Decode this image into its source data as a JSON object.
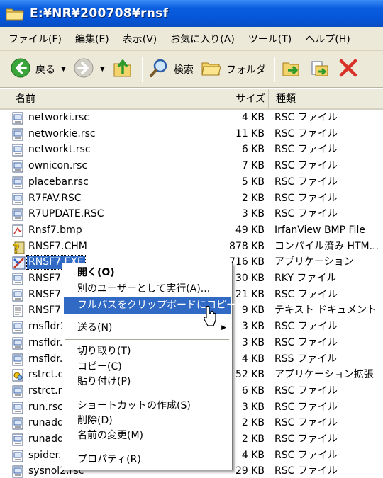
{
  "window": {
    "title": "E:¥NR¥200708¥rnsf"
  },
  "menubar": [
    "ファイル(F)",
    "編集(E)",
    "表示(V)",
    "お気に入り(A)",
    "ツール(T)",
    "ヘルプ(H)"
  ],
  "toolbar": {
    "back_label": "戻る",
    "search_label": "検索",
    "folders_label": "フォルダ"
  },
  "columns": {
    "name": "名前",
    "size": "サイズ",
    "type": "種類"
  },
  "files": [
    {
      "name": "networki.rsc",
      "size": "4 KB",
      "type": "RSC ファイル",
      "icon": "resource-file-icon"
    },
    {
      "name": "networkie.rsc",
      "size": "11 KB",
      "type": "RSC ファイル",
      "icon": "resource-file-icon"
    },
    {
      "name": "networkt.rsc",
      "size": "6 KB",
      "type": "RSC ファイル",
      "icon": "resource-file-icon"
    },
    {
      "name": "ownicon.rsc",
      "size": "7 KB",
      "type": "RSC ファイル",
      "icon": "resource-file-icon"
    },
    {
      "name": "placebar.rsc",
      "size": "5 KB",
      "type": "RSC ファイル",
      "icon": "resource-file-icon"
    },
    {
      "name": "R7FAV.RSC",
      "size": "2 KB",
      "type": "RSC ファイル",
      "icon": "resource-file-icon"
    },
    {
      "name": "R7UPDATE.RSC",
      "size": "3 KB",
      "type": "RSC ファイル",
      "icon": "resource-file-icon"
    },
    {
      "name": "Rnsf7.bmp",
      "size": "49 KB",
      "type": "IrfanView BMP File",
      "icon": "bitmap-file-icon"
    },
    {
      "name": "RNSF7.CHM",
      "size": "878 KB",
      "type": "コンパイル済み HTM...",
      "icon": "help-file-icon"
    },
    {
      "name": "RNSF7.EXE",
      "size": "716 KB",
      "type": "アプリケーション",
      "icon": "application-icon"
    },
    {
      "name": "RNSF7",
      "size": "30 KB",
      "type": "RKY ファイル",
      "icon": "resource-file-icon"
    },
    {
      "name": "RNSF7",
      "size": "21 KB",
      "type": "RSC ファイル",
      "icon": "resource-file-icon"
    },
    {
      "name": "RNSF7",
      "size": "9 KB",
      "type": "テキスト ドキュメント",
      "icon": "text-file-icon"
    },
    {
      "name": "rnsfldr2",
      "size": "3 KB",
      "type": "RSC ファイル",
      "icon": "resource-file-icon"
    },
    {
      "name": "rnsfldr.",
      "size": "3 KB",
      "type": "RSC ファイル",
      "icon": "resource-file-icon"
    },
    {
      "name": "rnsfldr.",
      "size": "4 KB",
      "type": "RSS ファイル",
      "icon": "resource-file-icon"
    },
    {
      "name": "rstrct.d",
      "size": "52 KB",
      "type": "アプリケーション拡張",
      "icon": "dll-file-icon"
    },
    {
      "name": "rstrct.r",
      "size": "6 KB",
      "type": "RSC ファイル",
      "icon": "resource-file-icon"
    },
    {
      "name": "run.rsc",
      "size": "3 KB",
      "type": "RSC ファイル",
      "icon": "resource-file-icon"
    },
    {
      "name": "runaddr",
      "size": "2 KB",
      "type": "RSC ファイル",
      "icon": "resource-file-icon"
    },
    {
      "name": "runaddr",
      "size": "2 KB",
      "type": "RSC ファイル",
      "icon": "resource-file-icon"
    },
    {
      "name": "spider.r",
      "size": "4 KB",
      "type": "RSC ファイル",
      "icon": "resource-file-icon"
    },
    {
      "name": "sysnol2.rsc",
      "size": "29 KB",
      "type": "RSC ファイル",
      "icon": "resource-file-icon"
    }
  ],
  "context_menu": {
    "open": "開く(O)",
    "run_as": "別のユーザーとして実行(A)...",
    "copy_full_path": "フルパスをクリップボードにコピー",
    "send_to": "送る(N)",
    "cut": "切り取り(T)",
    "copy": "コピー(C)",
    "paste": "貼り付け(P)",
    "create_shortcut": "ショートカットの作成(S)",
    "delete": "削除(D)",
    "rename": "名前の変更(M)",
    "properties": "プロパティ(R)"
  }
}
